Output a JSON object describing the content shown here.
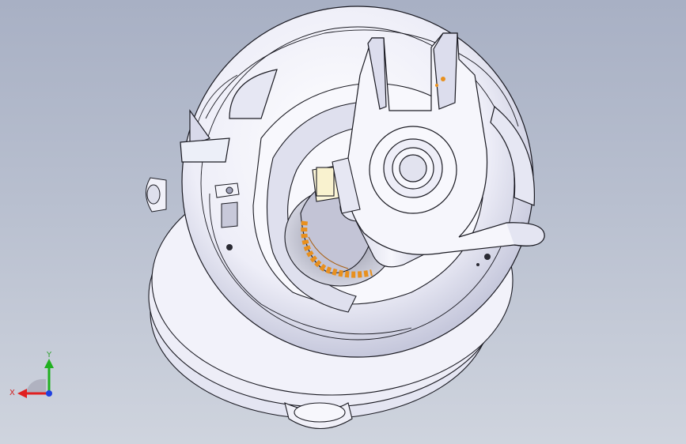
{
  "viewport": {
    "background_top": "#a8b0c4",
    "background_bottom": "#cfd4de"
  },
  "model": {
    "body_color": "#f4f4fb",
    "edge_color": "#1a1a22",
    "shade_color": "#c9cbe0",
    "spring_color": "#e8901e"
  },
  "triad": {
    "x_label": "X",
    "y_label": "Y",
    "x_color": "#e02020",
    "y_color": "#20b020",
    "z_color": "#2040e0"
  }
}
